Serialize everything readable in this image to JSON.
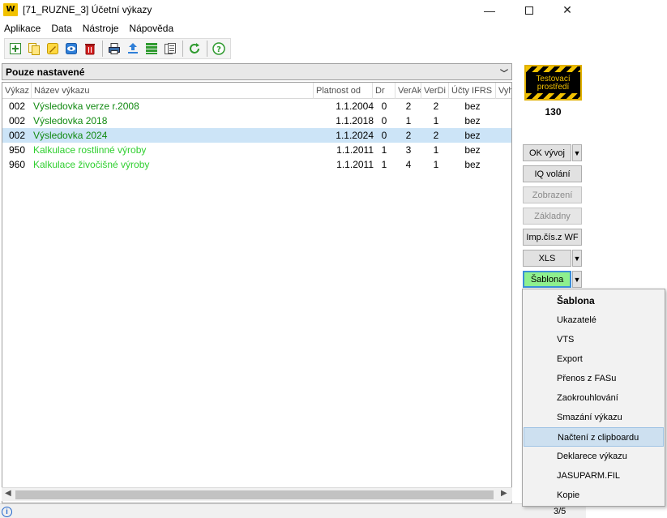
{
  "window": {
    "logo": "W",
    "title": "[71_RUZNE_3] Účetní výkazy",
    "minimize": "—",
    "close": "✕"
  },
  "menu": [
    "Aplikace",
    "Data",
    "Nástroje",
    "Nápověda"
  ],
  "toolbar_icons": [
    "add-icon",
    "copy-icon",
    "edit-icon",
    "view-icon",
    "delete-icon",
    "print-icon",
    "export-icon",
    "list-icon",
    "report-icon",
    "refresh-icon",
    "help-icon"
  ],
  "filter": {
    "label": "Pouze nastavené",
    "arrow": "﹀"
  },
  "columns": [
    "Výkaz",
    "Název výkazu",
    "Platnost od",
    "Dr",
    "VerAk",
    "VerDi",
    "Účty IFRS",
    "Vyh"
  ],
  "rows": [
    {
      "kod": "002",
      "nazev": "Výsledovka verze r.2008",
      "platnost": "1.1.2004",
      "dr": "0",
      "verak": "2",
      "verdi": "2",
      "ucty": "bez",
      "tone": "dark",
      "selected": false
    },
    {
      "kod": "002",
      "nazev": "Výsledovka 2018",
      "platnost": "1.1.2018",
      "dr": "0",
      "verak": "1",
      "verdi": "1",
      "ucty": "bez",
      "tone": "dark",
      "selected": false
    },
    {
      "kod": "002",
      "nazev": "Výsledovka 2024",
      "platnost": "1.1.2024",
      "dr": "0",
      "verak": "2",
      "verdi": "2",
      "ucty": "bez",
      "tone": "dark",
      "selected": true
    },
    {
      "kod": "950",
      "nazev": "Kalkulace rostlinné výroby",
      "platnost": "1.1.2011",
      "dr": "1",
      "verak": "3",
      "verdi": "1",
      "ucty": "bez",
      "tone": "light",
      "selected": false
    },
    {
      "kod": "960",
      "nazev": "Kalkulace živočišné výroby",
      "platnost": "1.1.2011",
      "dr": "1",
      "verak": "4",
      "verdi": "1",
      "ucty": "bez",
      "tone": "light",
      "selected": false
    }
  ],
  "status": {
    "info": "i",
    "page": "3/5"
  },
  "env": {
    "line1": "Testovací",
    "line2": "prostředí",
    "count": "130"
  },
  "buttons": {
    "ok_vyvoj": "OK vývoj",
    "iq_volani": "IQ volání",
    "zobrazeni": "Zobrazení",
    "zakladny": "Základny",
    "imp_cis": "Imp.čís.z WF",
    "xls": "XLS",
    "sablona": "Šablona",
    "dropdown_arrow": "▼"
  },
  "dropdown": [
    "Šablona",
    "Ukazatelé",
    "VTS",
    "Export",
    "Přenos z FASu",
    "Zaokrouhlování",
    "Smazání výkazu",
    "Načtení z clipboardu",
    "Deklarece výkazu",
    "JASUPARM.FIL",
    "Kopie"
  ],
  "colors": {
    "selected_row": "#cce4f7",
    "green_dark": "#118a11",
    "green_light": "#2fcf2f",
    "active_button": "#8ef08e"
  }
}
